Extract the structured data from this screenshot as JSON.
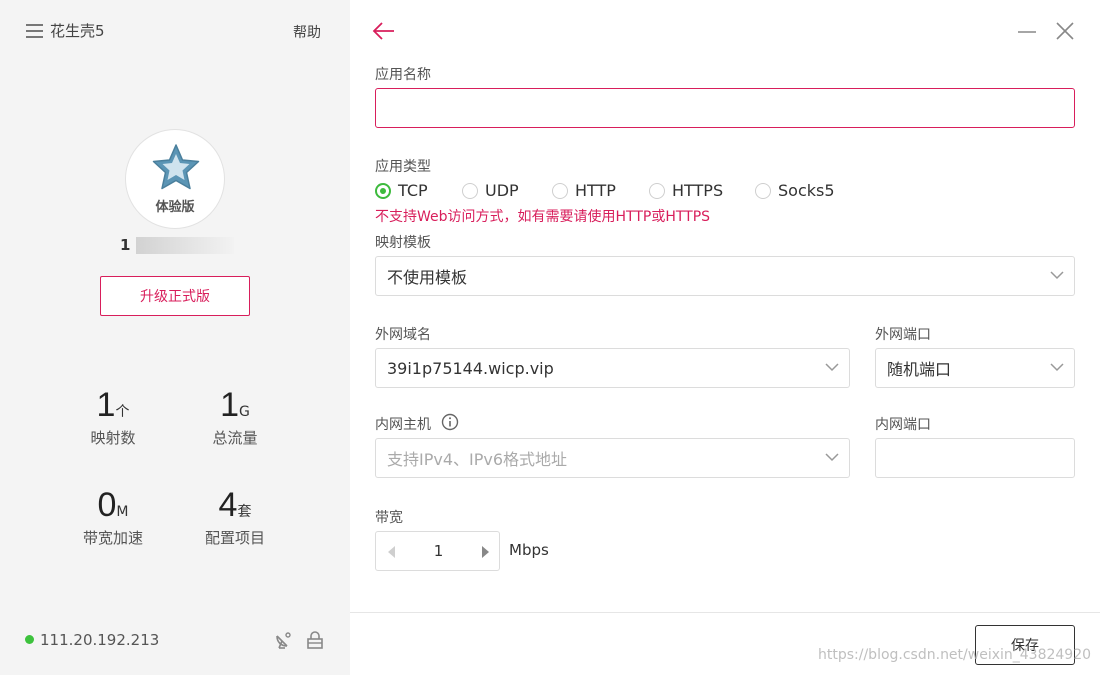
{
  "sidebar": {
    "app_title": "花生壳5",
    "help": "帮助",
    "badge_label": "体验版",
    "user_id_prefix": "1",
    "upgrade_button": "升级正式版",
    "stats": {
      "mappings": {
        "value": "1",
        "unit": "个",
        "label": "映射数"
      },
      "traffic": {
        "value": "1",
        "unit": "G",
        "label": "总流量"
      },
      "bandwidth": {
        "value": "0",
        "unit": "M",
        "label": "带宽加速"
      },
      "config": {
        "value": "4",
        "unit": "套",
        "label": "配置项目"
      }
    },
    "ip_address": "111.20.192.213",
    "status_color": "#3dc23d"
  },
  "form": {
    "app_name": {
      "label": "应用名称",
      "value": ""
    },
    "app_type": {
      "label": "应用类型",
      "options": [
        "TCP",
        "UDP",
        "HTTP",
        "HTTPS",
        "Socks5"
      ],
      "selected": "TCP",
      "warning": "不支持Web访问方式，如有需要请使用HTTP或HTTPS"
    },
    "template": {
      "label": "映射模板",
      "value": "不使用模板"
    },
    "external_domain": {
      "label": "外网域名",
      "value": "39i1p75144.wicp.vip"
    },
    "external_port": {
      "label": "外网端口",
      "value": "随机端口"
    },
    "internal_host": {
      "label": "内网主机",
      "placeholder": "支持IPv4、IPv6格式地址"
    },
    "internal_port": {
      "label": "内网端口",
      "value": ""
    },
    "bandwidth": {
      "label": "带宽",
      "value": "1",
      "unit": "Mbps"
    },
    "save_button": "保存"
  },
  "watermark": "https://blog.csdn.net/weixin_43824920",
  "colors": {
    "accent": "#d81e5b",
    "radio_checked": "#3dba3d",
    "sidebar_bg": "#f4f4f4"
  }
}
